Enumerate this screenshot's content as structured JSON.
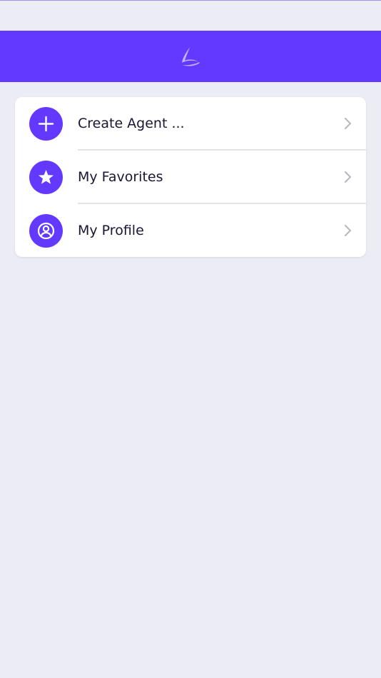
{
  "header": {
    "background_color": "#6338FF",
    "logo_icon": "app-logo-icon"
  },
  "menu": {
    "items": [
      {
        "label": "Create Agent ...",
        "icon": "plus-icon"
      },
      {
        "label": "My Favorites",
        "icon": "star-icon"
      },
      {
        "label": "My Profile",
        "icon": "user-circle-icon"
      }
    ]
  },
  "colors": {
    "accent": "#6338FF",
    "background": "#ECECF4",
    "card": "#FFFFFF",
    "text": "#1A1634",
    "chevron": "#B5B5BD"
  }
}
